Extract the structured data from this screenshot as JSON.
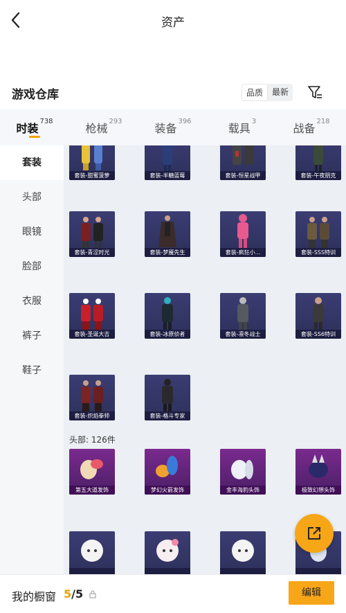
{
  "header": {
    "title": "资产"
  },
  "warehouse": {
    "title": "游戏仓库",
    "sort_options": [
      {
        "label": "品质",
        "active": true
      },
      {
        "label": "最新",
        "active": false
      }
    ]
  },
  "tabs": [
    {
      "label": "时装",
      "count": "738",
      "active": true
    },
    {
      "label": "枪械",
      "count": "293",
      "active": false
    },
    {
      "label": "装备",
      "count": "396",
      "active": false
    },
    {
      "label": "载具",
      "count": "3",
      "active": false
    },
    {
      "label": "战备",
      "count": "218",
      "active": false
    }
  ],
  "sidebar": {
    "items": [
      {
        "label": "套装",
        "active": true
      },
      {
        "label": "头部",
        "active": false
      },
      {
        "label": "眼镜",
        "active": false
      },
      {
        "label": "脸部",
        "active": false
      },
      {
        "label": "衣服",
        "active": false
      },
      {
        "label": "裤子",
        "active": false
      },
      {
        "label": "鞋子",
        "active": false
      }
    ]
  },
  "suits": [
    "套装-甜蜜菠萝",
    "套装-半糖蓝莓",
    "套装-恒星战甲",
    "套装-午夜朋克",
    "套装-青涩时光",
    "套装-梦魇先生",
    "套装-疯狂小...",
    "套装-SSS特训",
    "套装-圣诞大吉",
    "套装-冰原侦者",
    "套装-凛冬战士",
    "套装-SS6特训",
    "套装-炽焰拳师",
    "套装-格斗专家"
  ],
  "head_section": {
    "label": "头部: 126件",
    "items": [
      "第五大道发饰",
      "梦幻火箭发饰",
      "金丰海豹头饰",
      "极致幻想头饰",
      "",
      "",
      "",
      ""
    ]
  },
  "bottom": {
    "label": "我的橱窗",
    "count_current": "5",
    "count_sep": "/5",
    "edit_label": "编辑"
  },
  "colors": {
    "accent": "#f7a617",
    "card_dark": "#33356a",
    "card_purple": "#6a2580"
  }
}
